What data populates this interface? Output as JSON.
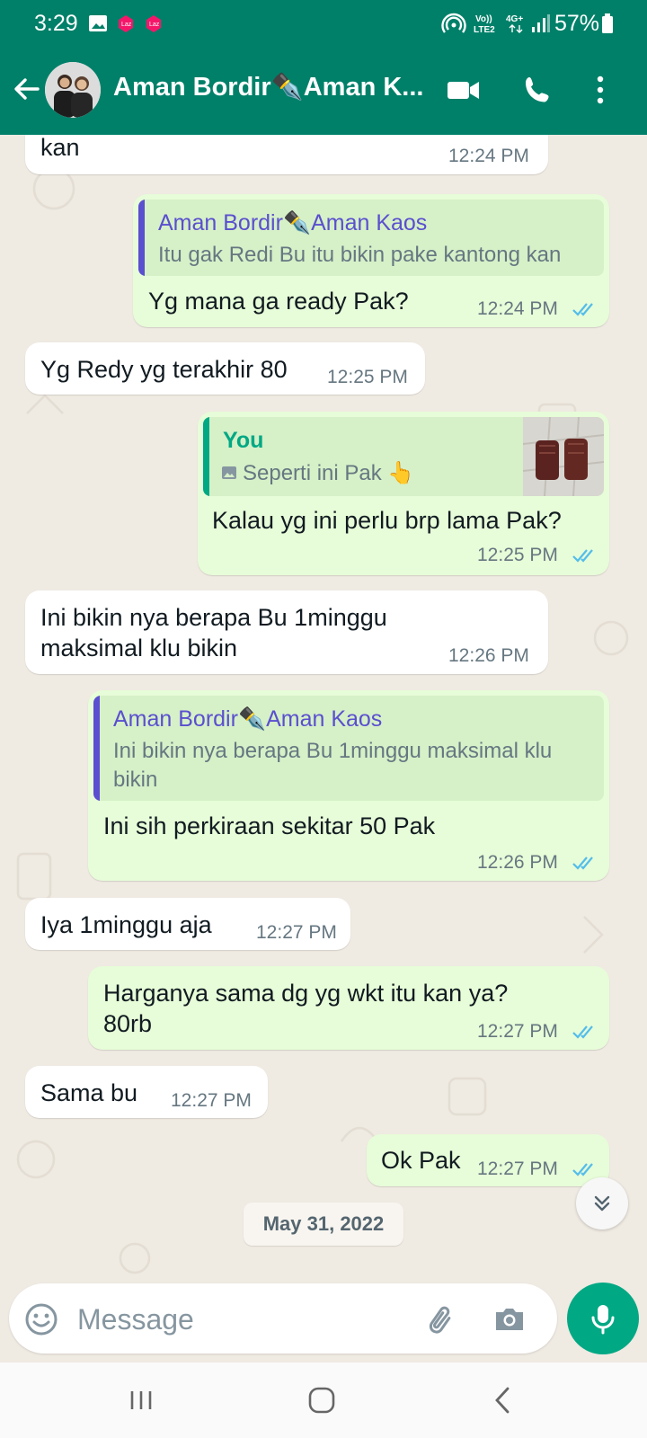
{
  "status_bar": {
    "time": "3:29",
    "battery": "57%",
    "icons": [
      "gallery-icon",
      "lazada-icon",
      "lazada-icon",
      "hotspot-icon",
      "volte-icon",
      "4g-icon",
      "signal-icon",
      "battery-icon"
    ]
  },
  "header": {
    "contact_name": "Aman Bordir✒️Aman K...",
    "icons": [
      "back-arrow-icon",
      "video-call-icon",
      "phone-icon",
      "more-options-icon"
    ]
  },
  "messages": [
    {
      "direction": "in",
      "text": "kan",
      "time": "12:24 PM"
    },
    {
      "direction": "out",
      "quote_author": "Aman Bordir✒️Aman Kaos",
      "quote_text": "Itu gak Redi Bu itu bikin pake kantong kan",
      "text": "Yg mana ga ready Pak?",
      "time": "12:24 PM",
      "status": "read"
    },
    {
      "direction": "in",
      "text": "Yg Redy yg terakhir 80",
      "time": "12:25 PM"
    },
    {
      "direction": "out",
      "quote_author": "You",
      "quote_text": "Seperti ini Pak 👆",
      "quote_has_photo": true,
      "text": "Kalau yg ini perlu brp lama Pak?",
      "time": "12:25 PM",
      "status": "read"
    },
    {
      "direction": "in",
      "text_lines": [
        "Ini bikin nya berapa Bu 1minggu",
        "maksimal klu bikin"
      ],
      "time": "12:26 PM"
    },
    {
      "direction": "out",
      "quote_author": "Aman Bordir✒️Aman Kaos",
      "quote_lines": [
        "Ini bikin nya berapa Bu 1minggu maksimal klu",
        "bikin"
      ],
      "text": "Ini sih perkiraan sekitar 50 Pak",
      "time": "12:26 PM",
      "status": "read"
    },
    {
      "direction": "in",
      "text": "Iya 1minggu aja",
      "time": "12:27 PM"
    },
    {
      "direction": "out",
      "text_lines": [
        "Harganya sama dg yg wkt itu kan ya?",
        "80rb"
      ],
      "time": "12:27 PM",
      "status": "read"
    },
    {
      "direction": "in",
      "text": "Sama bu",
      "time": "12:27 PM"
    },
    {
      "direction": "out",
      "text": "Ok Pak",
      "time": "12:27 PM",
      "status": "read"
    }
  ],
  "date_chip": "May 31, 2022",
  "composer": {
    "placeholder": "Message",
    "icons": [
      "emoji-icon",
      "attach-icon",
      "camera-icon",
      "mic-icon"
    ]
  },
  "colors": {
    "header": "#008069",
    "incoming": "#ffffff",
    "outgoing": "#e7fcd8",
    "quote_author_contact": "#5a4fcf",
    "quote_author_you": "#00a884",
    "read_ticks": "#53bdeb",
    "mic_button": "#00a884"
  }
}
